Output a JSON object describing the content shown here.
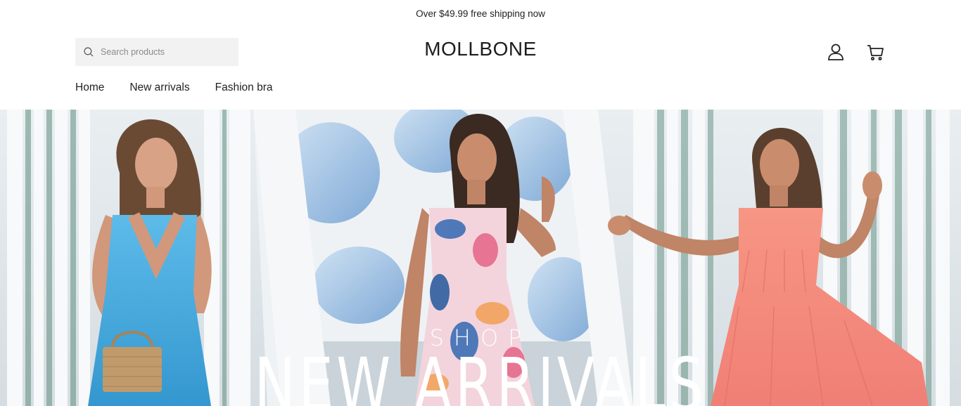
{
  "announcement": {
    "text": "Over $49.99 free shipping now"
  },
  "header": {
    "search_placeholder": "Search products",
    "logo": "MOLLBONE",
    "icons": {
      "account": "user-icon",
      "cart": "cart-icon",
      "search": "search-icon"
    }
  },
  "nav": {
    "items": [
      {
        "label": "Home"
      },
      {
        "label": "New arrivals"
      },
      {
        "label": "Fashion bra"
      }
    ]
  },
  "hero": {
    "subtitle": "SHOP",
    "title": "NEW ARRIVALS"
  },
  "colors": {
    "text": "#222222",
    "search_bg": "#f2f2f2",
    "dress_blue": "#4aaee0",
    "dress_coral": "#f48a7c",
    "dress_floral": "#e8a0b8"
  }
}
